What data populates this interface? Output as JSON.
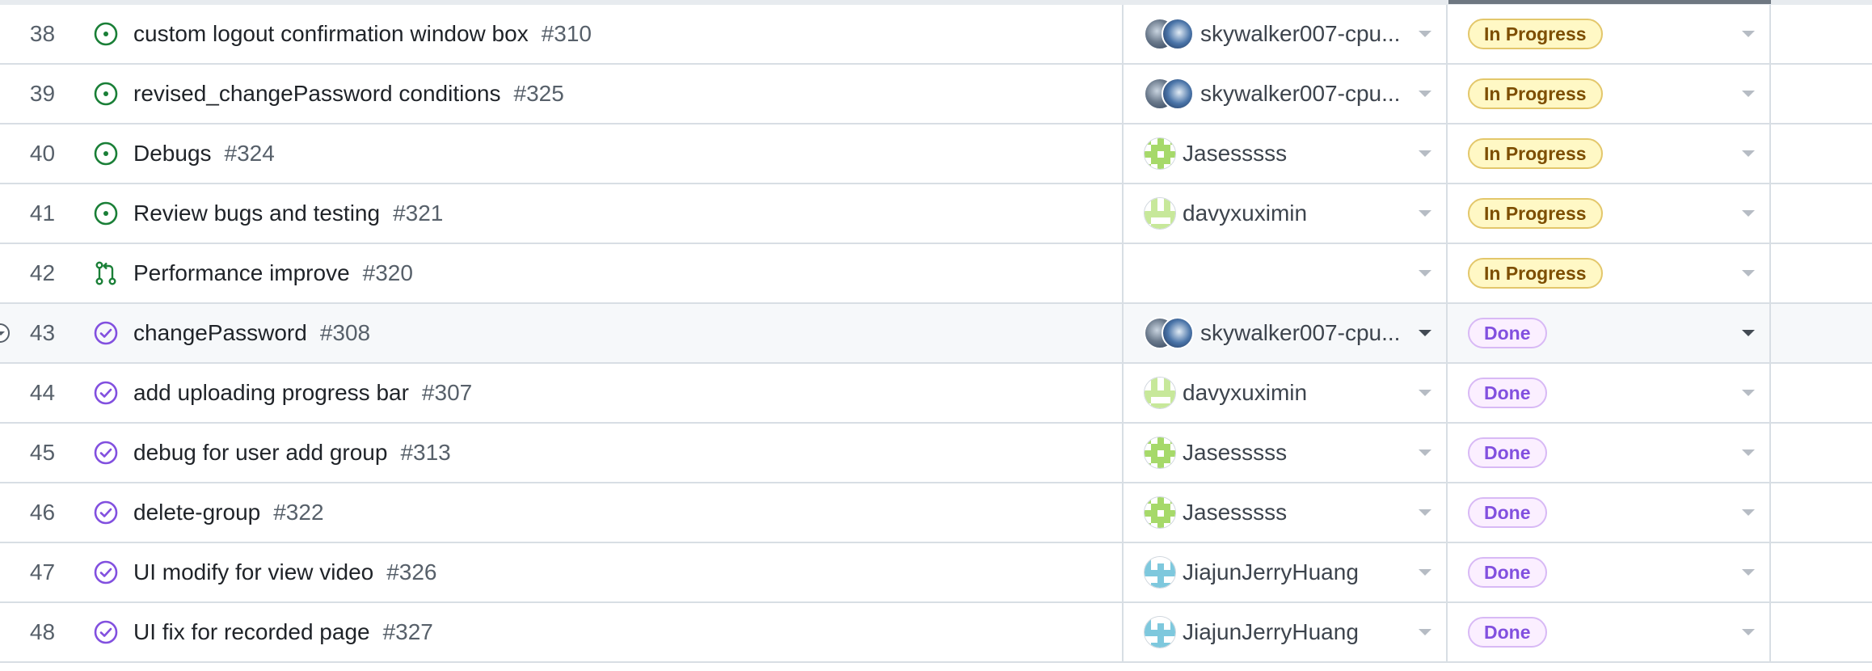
{
  "colors": {
    "open": "#1a7f37",
    "closed": "#8250df",
    "in_progress_bg": "#fff8c5",
    "in_progress_text": "#7d4e00",
    "done_bg": "#fbefff",
    "done_text": "#8250df"
  },
  "rows": [
    {
      "num": "38",
      "state": "open-issue-icon",
      "title": "custom logout confirmation window box",
      "issue": "#310",
      "assignee": "skywalker007-cpu...",
      "avatar": "pair",
      "status": "In Progress"
    },
    {
      "num": "39",
      "state": "open-issue-icon",
      "title": "revised_changePassword conditions",
      "issue": "#325",
      "assignee": "skywalker007-cpu...",
      "avatar": "pair",
      "status": "In Progress"
    },
    {
      "num": "40",
      "state": "open-issue-icon",
      "title": "Debugs",
      "issue": "#324",
      "assignee": "Jasesssss",
      "avatar": "green-pixel",
      "status": "In Progress"
    },
    {
      "num": "41",
      "state": "open-issue-icon",
      "title": "Review bugs and testing",
      "issue": "#321",
      "assignee": "davyxuximin",
      "avatar": "lime-pixel",
      "status": "In Progress"
    },
    {
      "num": "42",
      "state": "pull-request-icon",
      "title": "Performance improve",
      "issue": "#320",
      "assignee": "",
      "avatar": "none",
      "status": "In Progress"
    },
    {
      "num": "43",
      "state": "closed-issue-icon",
      "title": "changePassword",
      "issue": "#308",
      "assignee": "skywalker007-cpu...",
      "avatar": "pair",
      "status": "Done",
      "hovered": true
    },
    {
      "num": "44",
      "state": "closed-issue-icon",
      "title": "add uploading progress bar",
      "issue": "#307",
      "assignee": "davyxuximin",
      "avatar": "lime-pixel",
      "status": "Done"
    },
    {
      "num": "45",
      "state": "closed-issue-icon",
      "title": "debug for user add group",
      "issue": "#313",
      "assignee": "Jasesssss",
      "avatar": "green-pixel",
      "status": "Done"
    },
    {
      "num": "46",
      "state": "closed-issue-icon",
      "title": "delete-group",
      "issue": "#322",
      "assignee": "Jasesssss",
      "avatar": "green-pixel",
      "status": "Done"
    },
    {
      "num": "47",
      "state": "closed-issue-icon",
      "title": "UI modify for view video",
      "issue": "#326",
      "assignee": "JiajunJerryHuang",
      "avatar": "blue-pixel",
      "status": "Done"
    },
    {
      "num": "48",
      "state": "closed-issue-icon",
      "title": "UI fix for recorded page",
      "issue": "#327",
      "assignee": "JiajunJerryHuang",
      "avatar": "blue-pixel",
      "status": "Done"
    }
  ]
}
